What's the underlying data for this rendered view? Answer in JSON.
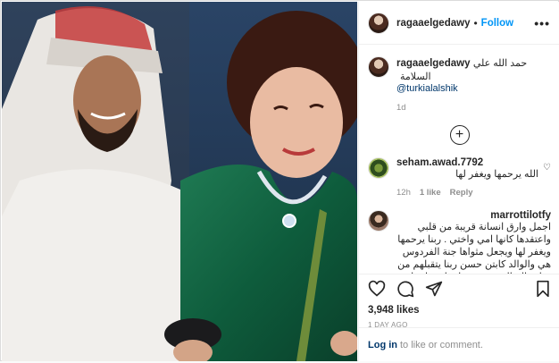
{
  "header": {
    "username": "ragaaelgedawy",
    "separator": "•",
    "follow_label": "Follow",
    "more_icon": "ellipsis-icon"
  },
  "caption": {
    "username": "ragaaelgedawy",
    "text": "حمد الله علي السلامة",
    "mention": "@turkialalshik",
    "time": "1d"
  },
  "load_more": {
    "icon": "plus-circle-icon"
  },
  "comments": [
    {
      "username": "seham.awad.7792",
      "text": "الله يرحمها ويغفر لها",
      "time": "12h",
      "likes": "1 like",
      "reply": "Reply"
    },
    {
      "username": "marrottilotfy",
      "text": "اجمل وارق انسانة قريبة من قلبي واعتقدها كانها امي واختي . ربنا يرحمها ويغفر لها ويجعل مثواها جنة الفردوس هي والوالد كابتن حسن ربنا يتقبلهم من عباده الصالحين ويسعدك يارب استاذة ويبارك لحضرتك في روضة"
    }
  ],
  "actions": {
    "like_icon": "heart-icon",
    "comment_icon": "comment-icon",
    "share_icon": "paper-plane-icon",
    "save_icon": "bookmark-icon",
    "likes_count": "3,948 likes",
    "posted_ago": "1 DAY AGO"
  },
  "login": {
    "link_label": "Log in",
    "rest": "to like or comment."
  }
}
